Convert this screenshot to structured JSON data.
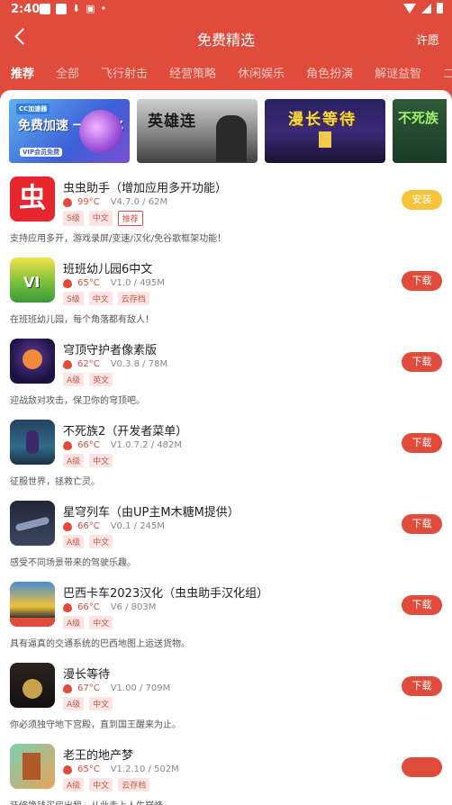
{
  "status": {
    "time": "2:40"
  },
  "appbar": {
    "title": "免费精选",
    "permission": "许愿"
  },
  "tabs": [
    "推荐",
    "全部",
    "飞行射击",
    "经营策略",
    "休闲娱乐",
    "角色扮演",
    "解谜益智",
    "二次元"
  ],
  "banners": [
    {
      "title": "免费加速 一键汉化",
      "tag": "CC加速器",
      "sub": "VIP会员免费"
    },
    {
      "title": "英雄连"
    },
    {
      "title": "漫长等待"
    },
    {
      "title": "不死族"
    }
  ],
  "apps": [
    {
      "name": "虫虫助手（增加应用多开功能）",
      "temp": "99°C",
      "version": "V4.7.0 / 62M",
      "tags": [
        "S级",
        "中文"
      ],
      "rec": "推荐",
      "desc": "支持应用多开，游戏录屏/变速/汉化/免谷歌框架功能！",
      "button": "安装"
    },
    {
      "name": "班班幼儿园6中文",
      "temp": "65°C",
      "version": "V1.0 / 495M",
      "tags": [
        "S级",
        "中文",
        "云存档"
      ],
      "desc": "在班班幼儿园，每个角落都有敌人！",
      "button": "下载"
    },
    {
      "name": "穹顶守护者像素版",
      "temp": "62°C",
      "version": "V0.3.8 / 78M",
      "tags": [
        "A级",
        "英文"
      ],
      "desc": "迎战敌对攻击，保卫你的穹顶吧。",
      "button": "下载"
    },
    {
      "name": "不死族2（开发者菜单）",
      "temp": "66°C",
      "version": "V1.0.7.2 / 482M",
      "tags": [
        "A级",
        "中文"
      ],
      "desc": "征服世界，拯救亡灵。",
      "button": "下载"
    },
    {
      "name": "星穹列车（由UP主M木糖M提供）",
      "temp": "66°C",
      "version": "V0.1 / 245M",
      "tags": [
        "A级",
        "中文"
      ],
      "desc": "感受不同场景带来的驾驶乐趣。",
      "button": "下载"
    },
    {
      "name": "巴西卡车2023汉化（虫虫助手汉化组）",
      "temp": "66°C",
      "version": "V6 / 803M",
      "tags": [
        "A级",
        "中文"
      ],
      "desc": "具有逼真的交通系统的巴西地图上运送货物。",
      "button": "下载"
    },
    {
      "name": "漫长等待",
      "temp": "67°C",
      "version": "V1.00 / 709M",
      "tags": [
        "A级",
        "中文"
      ],
      "desc": "你必须独守地下宫殿，直到国王醒来为止。",
      "button": "下载"
    },
    {
      "name": "老王的地产梦",
      "temp": "65°C",
      "version": "V1.2.10 / 502M",
      "tags": [
        "A级",
        "中文",
        "云存档"
      ],
      "desc": "装修换钱买房出租，从此走上人生巅峰。",
      "button": ""
    }
  ],
  "colors": {
    "brand": "#e04b3c",
    "install": "#f5c23a"
  }
}
